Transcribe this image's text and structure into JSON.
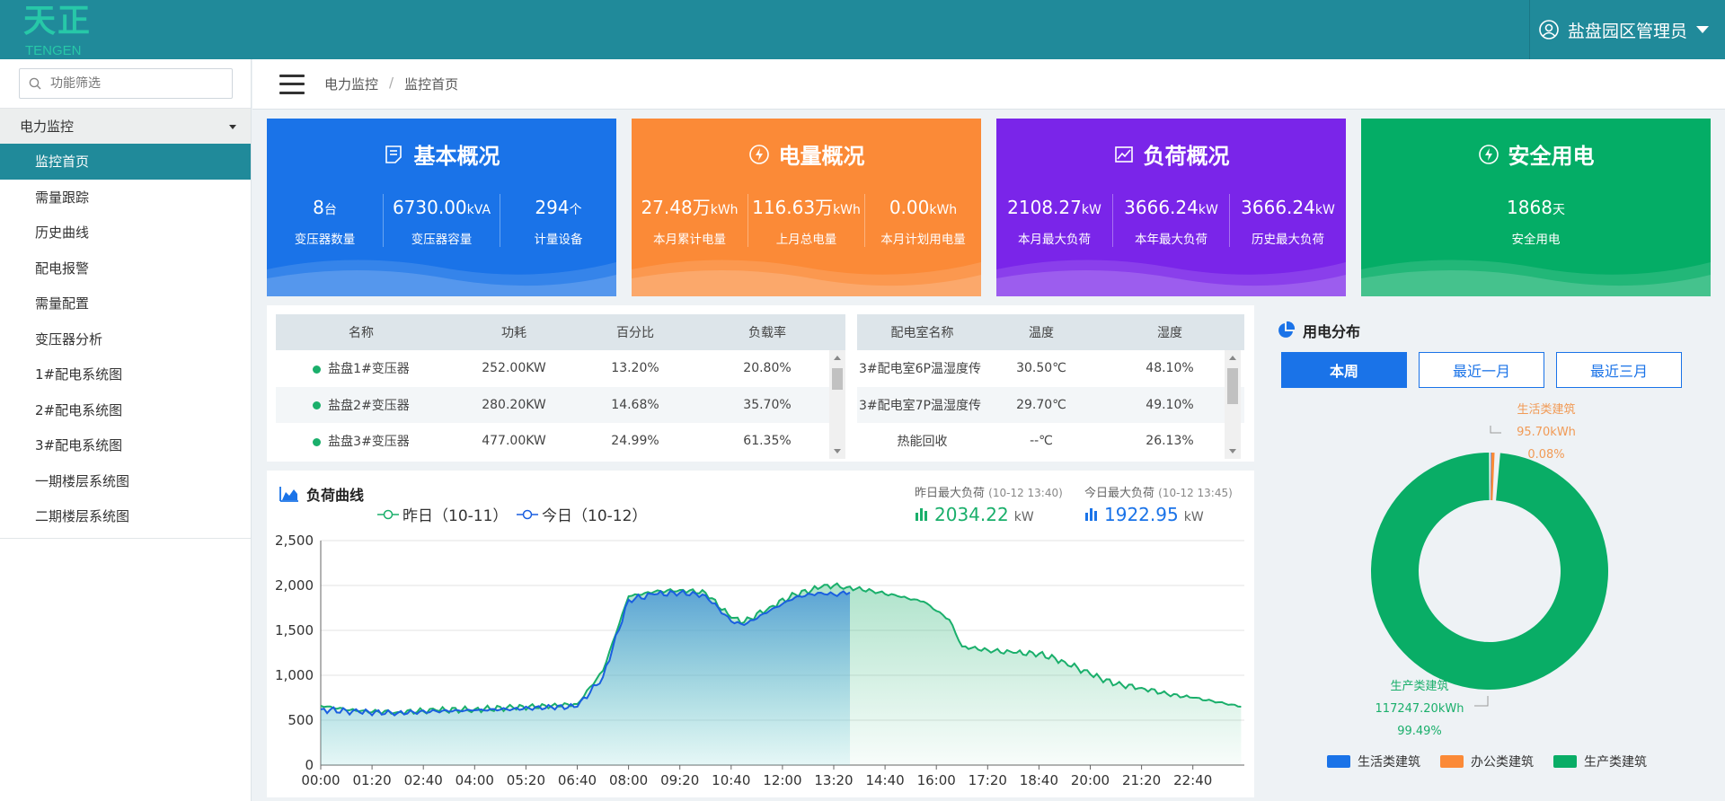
{
  "brand": {
    "logo_cn": "天正",
    "logo_en": "TENGEN"
  },
  "user": {
    "name": "盐盘园区管理员"
  },
  "sidebar": {
    "search_placeholder": "功能筛选",
    "group": "电力监控",
    "items": [
      {
        "label": "监控首页",
        "active": true
      },
      {
        "label": "需量跟踪"
      },
      {
        "label": "历史曲线"
      },
      {
        "label": "配电报警"
      },
      {
        "label": "需量配置"
      },
      {
        "label": "变压器分析"
      },
      {
        "label": "1#配电系统图"
      },
      {
        "label": "2#配电系统图"
      },
      {
        "label": "3#配电系统图"
      },
      {
        "label": "一期楼层系统图"
      },
      {
        "label": "二期楼层系统图"
      }
    ]
  },
  "breadcrumb": {
    "level1": "电力监控",
    "separator": "/",
    "level2": "监控首页"
  },
  "cards": [
    {
      "title": "基本概况",
      "color": "#1a73e8",
      "icon": "document-icon",
      "stats": [
        {
          "value": "8",
          "unit": "台",
          "label": "变压器数量"
        },
        {
          "value": "6730.00",
          "unit": "kVA",
          "label": "变压器容量"
        },
        {
          "value": "294",
          "unit": "个",
          "label": "计量设备"
        }
      ]
    },
    {
      "title": "电量概况",
      "color": "#fb8a37",
      "icon": "lightning-icon",
      "stats": [
        {
          "value": "27.48万",
          "unit": "kWh",
          "label": "本月累计电量"
        },
        {
          "value": "116.63万",
          "unit": "kWh",
          "label": "上月总电量"
        },
        {
          "value": "0.00",
          "unit": "kWh",
          "label": "本月计划用电量"
        }
      ]
    },
    {
      "title": "负荷概况",
      "color": "#7a25e9",
      "icon": "chart-icon",
      "stats": [
        {
          "value": "2108.27",
          "unit": "kW",
          "label": "本月最大负荷"
        },
        {
          "value": "3666.24",
          "unit": "kW",
          "label": "本年最大负荷"
        },
        {
          "value": "3666.24",
          "unit": "kW",
          "label": "历史最大负荷"
        }
      ]
    },
    {
      "title": "安全用电",
      "color": "#04ad66",
      "icon": "lightning-icon",
      "stats": [
        {
          "value": "1868",
          "unit": "天",
          "label": "安全用电"
        }
      ]
    }
  ],
  "transformer_table": {
    "headers": [
      "名称",
      "功耗",
      "百分比",
      "负载率"
    ],
    "rows": [
      [
        "盐盘1#变压器",
        "252.00KW",
        "13.20%",
        "20.80%"
      ],
      [
        "盐盘2#变压器",
        "280.20KW",
        "14.68%",
        "35.70%"
      ],
      [
        "盐盘3#变压器",
        "477.00KW",
        "24.99%",
        "61.35%"
      ]
    ]
  },
  "room_table": {
    "headers": [
      "配电室名称",
      "温度",
      "湿度"
    ],
    "rows": [
      [
        "3#配电室6P温湿度传",
        "30.50℃",
        "48.10%"
      ],
      [
        "3#配电室7P温湿度传",
        "29.70℃",
        "49.10%"
      ],
      [
        "热能回收",
        "--℃",
        "26.13%"
      ]
    ]
  },
  "load_panel": {
    "title": "负荷曲线",
    "legend_yesterday": "昨日（10-11）",
    "legend_today": "今日（10-12）",
    "yesterday_max_label": "昨日最大负荷",
    "yesterday_max_time": "(10-12 13:40)",
    "yesterday_max_value": "2034.22",
    "today_max_label": "今日最大负荷",
    "today_max_time": "(10-12 13:45)",
    "today_max_value": "1922.95",
    "unit": "kW",
    "colors": {
      "yesterday": "#1aaf6b",
      "today": "#1a5fe0"
    }
  },
  "chart_data": {
    "type": "area",
    "title": "负荷曲线",
    "xlabel": "",
    "ylabel": "",
    "ylim": [
      0,
      2500
    ],
    "yticks": [
      "0",
      "500",
      "1,000",
      "1,500",
      "2,000",
      "2,500"
    ],
    "xticks": [
      "00:00",
      "01:20",
      "02:40",
      "04:00",
      "05:20",
      "06:40",
      "08:00",
      "09:20",
      "10:40",
      "12:00",
      "13:20",
      "14:40",
      "16:00",
      "17:20",
      "18:40",
      "20:00",
      "21:20",
      "22:40"
    ],
    "grid": true,
    "series": [
      {
        "name": "昨日（10-11）",
        "x": [
          "00:00",
          "01:00",
          "02:00",
          "03:00",
          "04:00",
          "05:00",
          "06:00",
          "06:40",
          "07:20",
          "08:00",
          "08:40",
          "09:20",
          "10:00",
          "10:40",
          "11:00",
          "11:40",
          "12:20",
          "13:00",
          "13:20",
          "13:40",
          "14:20",
          "15:00",
          "15:40",
          "16:20",
          "16:40",
          "17:20",
          "18:00",
          "18:40",
          "19:20",
          "20:00",
          "20:40",
          "21:20",
          "22:00",
          "22:40",
          "23:20",
          "23:55"
        ],
        "values": [
          660,
          600,
          590,
          610,
          620,
          640,
          660,
          680,
          1050,
          1880,
          1930,
          1950,
          1920,
          1640,
          1590,
          1760,
          1900,
          1980,
          2000,
          1980,
          1940,
          1880,
          1820,
          1620,
          1320,
          1280,
          1250,
          1240,
          1150,
          1010,
          900,
          860,
          790,
          750,
          700,
          650
        ]
      },
      {
        "name": "今日（10-12）",
        "x": [
          "00:00",
          "01:00",
          "02:00",
          "03:00",
          "04:00",
          "05:00",
          "06:00",
          "06:40",
          "07:20",
          "08:00",
          "08:40",
          "09:20",
          "10:00",
          "10:40",
          "11:00",
          "11:40",
          "12:20",
          "13:00",
          "13:20",
          "13:45"
        ],
        "values": [
          620,
          590,
          580,
          600,
          610,
          625,
          645,
          650,
          980,
          1840,
          1900,
          1920,
          1890,
          1600,
          1560,
          1720,
          1870,
          1920,
          1900,
          1922.95
        ]
      }
    ]
  },
  "distribution": {
    "title": "用电分布",
    "buttons": [
      {
        "label": "本周",
        "active": true
      },
      {
        "label": "最近一月"
      },
      {
        "label": "最近三月"
      }
    ],
    "labels": {
      "small_names": "生活类建筑",
      "small_value": "95.70kWh",
      "small_pct": "0.08%",
      "big_name": "生产类建筑",
      "big_value": "117247.20kWh",
      "big_pct": "99.49%"
    },
    "legend": [
      {
        "label": "生活类建筑",
        "color": "#1a73e8"
      },
      {
        "label": "办公类建筑",
        "color": "#fb8a37"
      },
      {
        "label": "生产类建筑",
        "color": "#09ad66"
      }
    ]
  },
  "pie_data": {
    "type": "pie",
    "slices": [
      {
        "name": "生活类建筑",
        "value": 95.7,
        "pct": 0.08
      },
      {
        "name": "办公类建筑",
        "value": 0,
        "pct": 0.43
      },
      {
        "name": "生产类建筑",
        "value": 117247.2,
        "pct": 99.49
      }
    ]
  }
}
